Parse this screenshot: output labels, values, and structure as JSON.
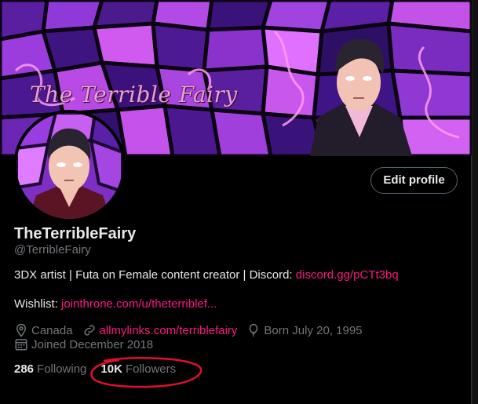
{
  "banner": {
    "logo_text": "The Terrible Fairy"
  },
  "profile": {
    "edit_button_label": "Edit profile",
    "display_name": "TheTerribleFairy",
    "handle": "@TerribleFairy",
    "bio_text": "3DX artist | Futa on Female content creator | Discord: ",
    "bio_link": "discord.gg/pCTt3bq",
    "wishlist_label": "Wishlist: ",
    "wishlist_link": "jointhrone.com/u/theterriblef...",
    "location": "Canada",
    "website": "allmylinks.com/terriblefairy",
    "birthday": "Born July 20, 1995",
    "joined": "Joined December 2018",
    "following_count": "286",
    "following_label": "Following",
    "followers_count": "10K",
    "followers_label": "Followers"
  },
  "colors": {
    "accent_link": "#f91880",
    "secondary_text": "#71767b",
    "primary_text": "#e7e9ea",
    "annotation_circle": "#e0102a"
  },
  "icons": {
    "location": "map-pin-icon",
    "website": "link-icon",
    "birthday": "balloon-icon",
    "joined": "calendar-icon"
  }
}
